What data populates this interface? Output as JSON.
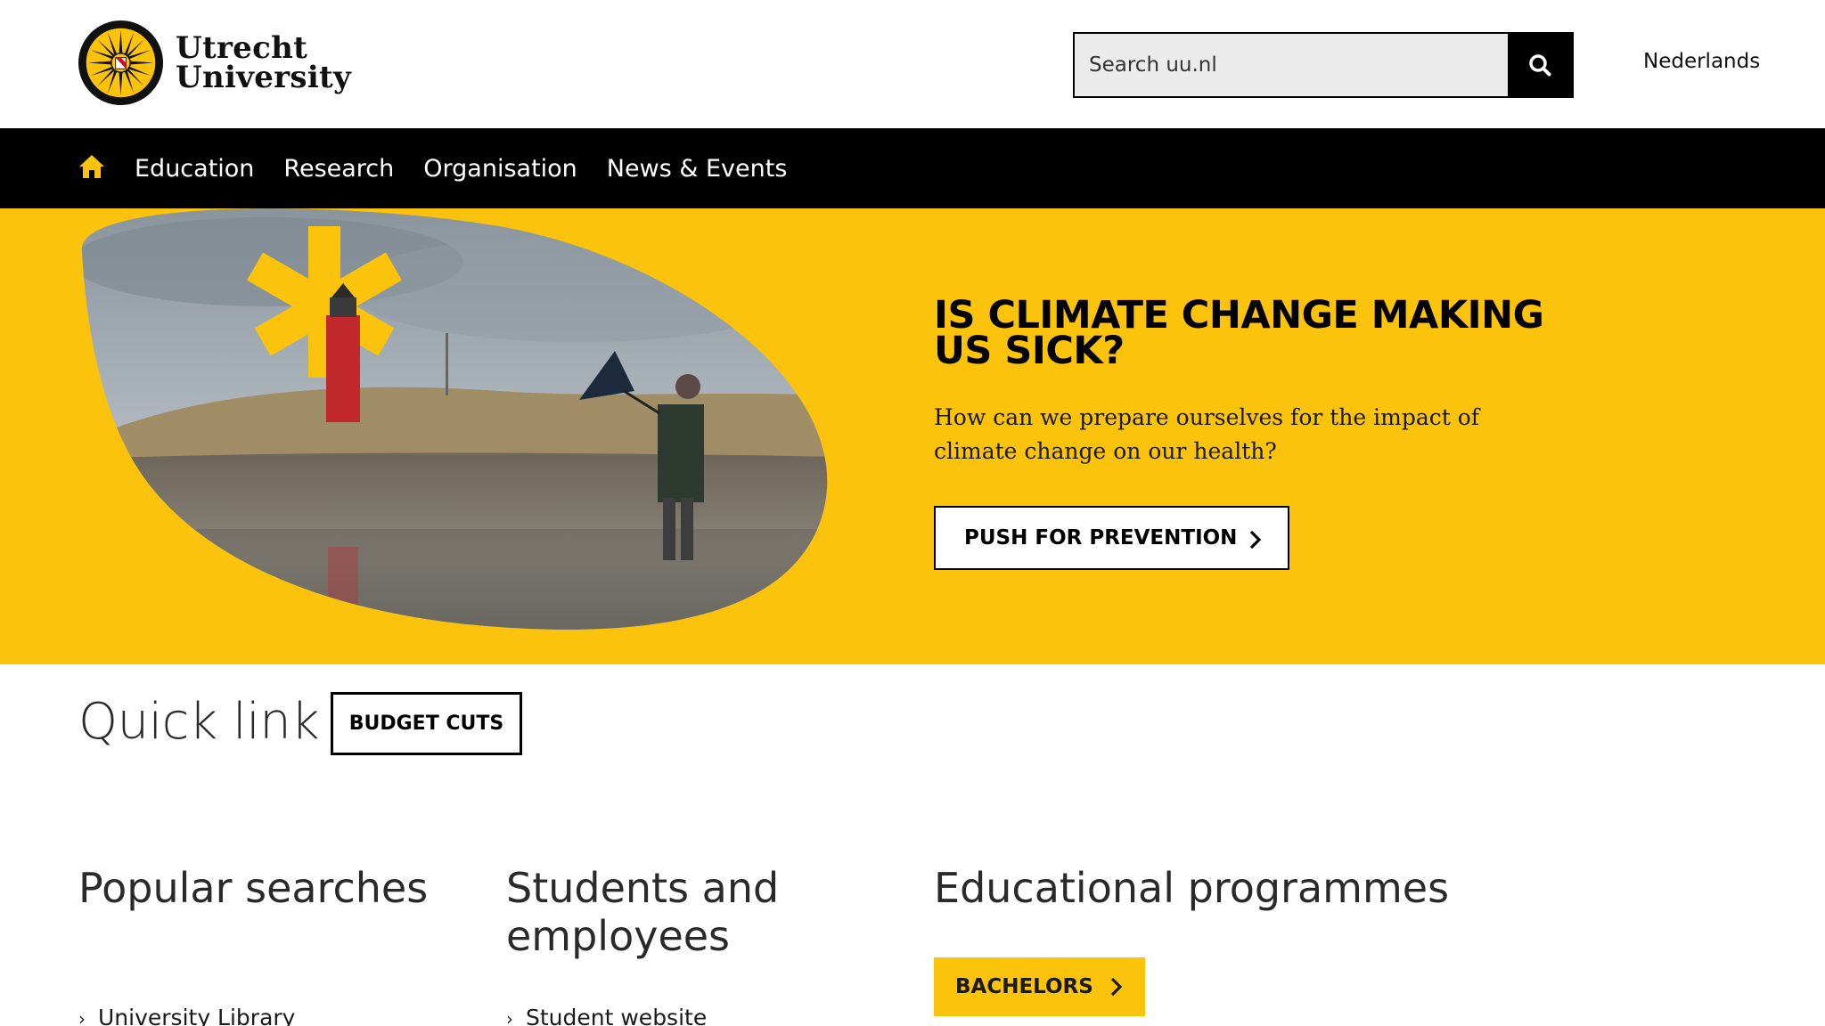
{
  "header": {
    "logo_line1": "Utrecht",
    "logo_line2": "University",
    "search_placeholder": "Search uu.nl",
    "language_link": "Nederlands"
  },
  "nav": {
    "home_icon": "home-icon",
    "items": [
      "Education",
      "Research",
      "Organisation",
      "News & Events"
    ]
  },
  "hero": {
    "title": "IS CLIMATE CHANGE MAKING US SICK?",
    "subtitle": "How can we prepare ourselves for the impact of climate change on our health?",
    "button_label": "PUSH FOR PREVENTION",
    "accent_color": "#fbc30b"
  },
  "quick_link": {
    "title": "Quick link",
    "button_label": "BUDGET CUTS"
  },
  "columns": {
    "popular": {
      "title": "Popular searches",
      "links": [
        "University Library"
      ]
    },
    "students": {
      "title": "Students and employees",
      "links": [
        "Student website"
      ]
    },
    "programmes": {
      "title": "Educational programmes",
      "button_label": "BACHELORS"
    }
  }
}
